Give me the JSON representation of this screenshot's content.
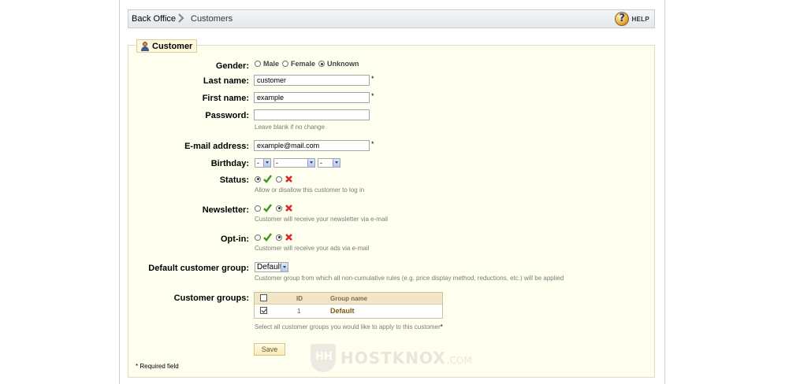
{
  "breadcrumb": {
    "home": "Back Office",
    "current": "Customers"
  },
  "help": {
    "label": "HELP"
  },
  "section": {
    "title": "Customer"
  },
  "form": {
    "gender": {
      "label": "Gender:",
      "options": [
        "Male",
        "Female",
        "Unknown"
      ],
      "selected": "Unknown"
    },
    "last_name": {
      "label": "Last name:",
      "value": "customer",
      "required": "*"
    },
    "first_name": {
      "label": "First name:",
      "value": "example",
      "required": "*"
    },
    "password": {
      "label": "Password:",
      "value": "",
      "hint": "Leave blank if no change"
    },
    "email": {
      "label": "E-mail address:",
      "value": "example@mail.com",
      "required": "*"
    },
    "birthday": {
      "label": "Birthday:",
      "day": "-",
      "month": "-",
      "year": "-"
    },
    "status": {
      "label": "Status:",
      "selected": "enabled",
      "hint": "Allow or disallow this customer to log in"
    },
    "newsletter": {
      "label": "Newsletter:",
      "selected": "disabled",
      "hint": "Customer will receive your newsletter via e-mail"
    },
    "optin": {
      "label": "Opt-in:",
      "selected": "disabled",
      "hint": "Customer will receive your ads via e-mail"
    },
    "default_group": {
      "label": "Default customer group:",
      "value": "Default",
      "hint": "Customer group from which all non-cumulative rules (e.g. price display method, reductions, etc.) will be applied"
    },
    "customer_groups": {
      "label": "Customer groups:",
      "columns": [
        "ID",
        "Group name"
      ],
      "rows": [
        {
          "id": "1",
          "name": "Default",
          "checked": true
        }
      ],
      "hint": "Select all customer groups you would like to apply to this customer",
      "required": "*"
    },
    "save_label": "Save",
    "required_note": "* Required field"
  },
  "watermark": {
    "brand": "HOSTKNOX",
    "domain": ".COM"
  },
  "colors": {
    "accept": "#3a9a1e",
    "reject": "#d8282a",
    "panel_bg": "#fffff0"
  }
}
